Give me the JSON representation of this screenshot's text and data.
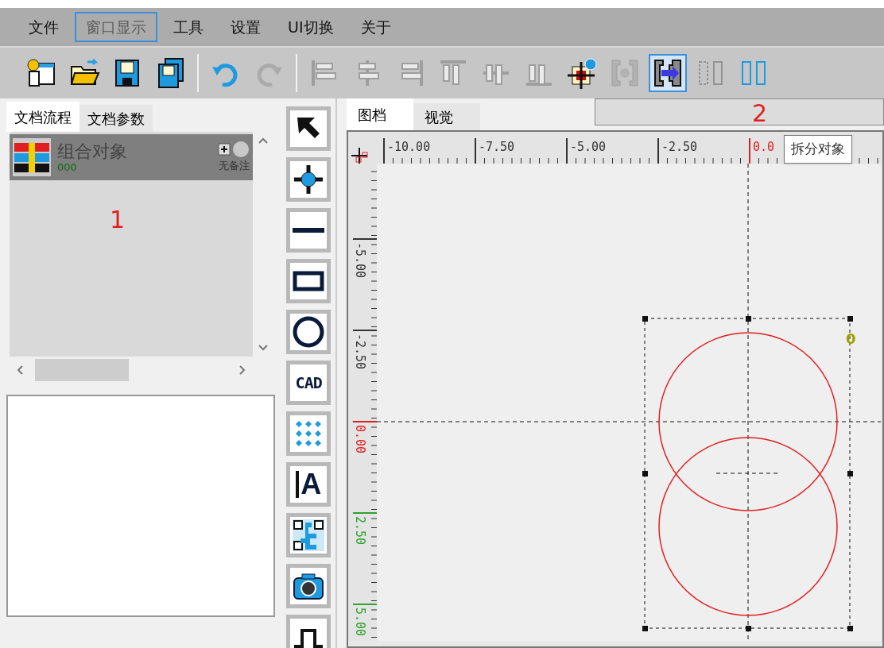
{
  "menu": [
    {
      "label": "文件",
      "selected": false
    },
    {
      "label": "窗口显示",
      "selected": true
    },
    {
      "label": "工具",
      "selected": false
    },
    {
      "label": "设置",
      "selected": false
    },
    {
      "label": "UI切换",
      "selected": false
    },
    {
      "label": "关于",
      "selected": false
    }
  ],
  "toolbar": [
    {
      "kind": "new",
      "disabled": false,
      "selected": false
    },
    {
      "kind": "open",
      "disabled": false,
      "selected": false
    },
    {
      "kind": "save",
      "disabled": false,
      "selected": false
    },
    {
      "kind": "save-all",
      "disabled": false,
      "selected": false
    },
    {
      "kind": "separator"
    },
    {
      "kind": "undo",
      "disabled": false,
      "selected": false
    },
    {
      "kind": "redo",
      "disabled": true,
      "selected": false
    },
    {
      "kind": "separator"
    },
    {
      "kind": "align-left",
      "disabled": true,
      "selected": false
    },
    {
      "kind": "align-center",
      "disabled": true,
      "selected": false
    },
    {
      "kind": "align-right",
      "disabled": true,
      "selected": false
    },
    {
      "kind": "align-top",
      "disabled": true,
      "selected": false
    },
    {
      "kind": "align-middle",
      "disabled": true,
      "selected": false
    },
    {
      "kind": "align-bottom",
      "disabled": true,
      "selected": false
    },
    {
      "kind": "target",
      "disabled": false,
      "selected": false
    },
    {
      "kind": "combine",
      "disabled": true,
      "selected": false
    },
    {
      "kind": "split",
      "disabled": false,
      "selected": true
    },
    {
      "kind": "distribute",
      "disabled": true,
      "selected": false
    },
    {
      "kind": "distribute",
      "disabled": false,
      "selected": false
    }
  ],
  "left_panel": {
    "tabs": [
      {
        "label": "文档流程",
        "selected": true
      },
      {
        "label": "文档参数",
        "selected": false
      }
    ],
    "items": [
      {
        "name": "组合对象",
        "code": "000",
        "note": "无备注",
        "selected": true
      }
    ]
  },
  "tools": [
    {
      "kind": "pointer"
    },
    {
      "kind": "node"
    },
    {
      "kind": "line"
    },
    {
      "kind": "rectangle"
    },
    {
      "kind": "circle"
    },
    {
      "kind": "cad",
      "label": "CAD"
    },
    {
      "kind": "dots"
    },
    {
      "kind": "text",
      "label": "A"
    },
    {
      "kind": "qr"
    },
    {
      "kind": "camera"
    },
    {
      "kind": "pulse"
    }
  ],
  "canvas_panel": {
    "tabs": [
      {
        "label": "图档",
        "selected": true
      },
      {
        "label": "视觉",
        "selected": false
      }
    ],
    "top_ruler": [
      {
        "text": "-10.00",
        "kind": "negative"
      },
      {
        "text": "-7.50",
        "kind": "negative"
      },
      {
        "text": "-5.00",
        "kind": "negative"
      },
      {
        "text": "-2.50",
        "kind": "negative"
      },
      {
        "text": "0.0",
        "kind": "zero"
      }
    ],
    "left_ruler": [
      {
        "text": "-5.00",
        "kind": "negative"
      },
      {
        "text": "-2.50",
        "kind": "negative"
      },
      {
        "text": "0.00",
        "kind": "zero"
      },
      {
        "text": "2.50",
        "kind": "positive"
      },
      {
        "text": "5.00",
        "kind": "positive"
      }
    ],
    "object_label": "0",
    "tooltip": "拆分对象"
  },
  "annotations": [
    "1",
    "2"
  ]
}
